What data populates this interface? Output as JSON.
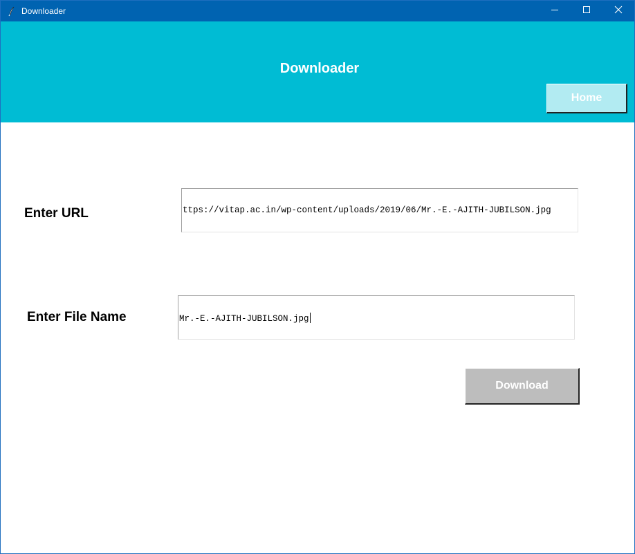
{
  "window": {
    "title": "Downloader",
    "icons": {
      "app": "feather-icon",
      "minimize": "minimize-icon",
      "maximize": "maximize-icon",
      "close": "close-icon"
    },
    "titlebar_color": "#0063b1"
  },
  "header": {
    "title": "Downloader",
    "home_label": "Home",
    "background": "#00bcd4"
  },
  "form": {
    "url_label": "Enter URL",
    "url_value": "ttps://vitap.ac.in/wp-content/uploads/2019/06/Mr.-E.-AJITH-JUBILSON.jpg",
    "file_label": "Enter File Name",
    "file_value": "Mr.-E.-AJITH-JUBILSON.jpg",
    "download_label": "Download"
  }
}
